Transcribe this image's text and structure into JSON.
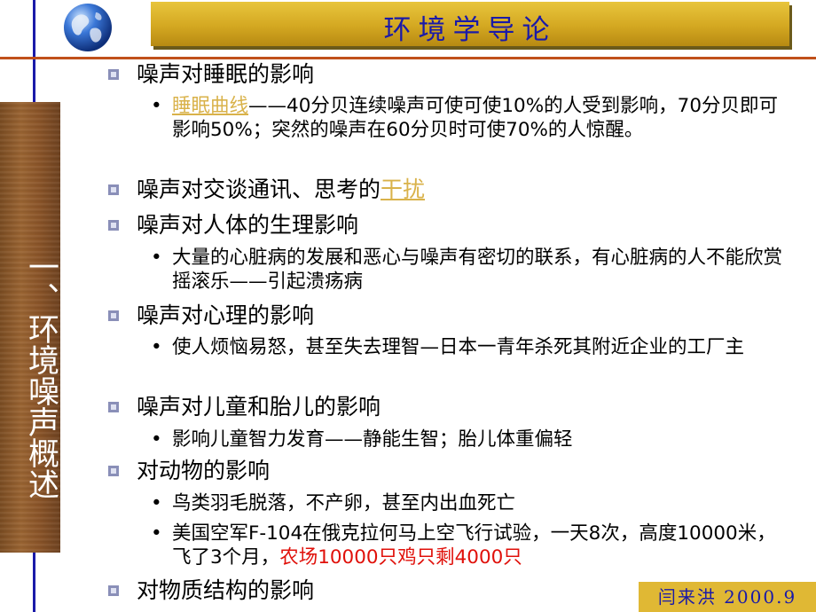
{
  "title": "环境学导论",
  "side_title": "一、环境噪声概述",
  "footer": "闫来洪 2000.9",
  "colors": {
    "title_blue": "#1a1aa8",
    "gold": "#d4a821",
    "link_gold": "#d9b24a",
    "red": "#e0100a"
  },
  "items": [
    {
      "heading": "噪声对睡眠的影响",
      "sub": [
        {
          "link": "睡眠曲线",
          "text": "——40分贝连续噪声可使可使10%的人受到影响，70分贝即可影响50%；突然的噪声在60分贝时可使70%的人惊醒。"
        }
      ]
    },
    {
      "heading_pre": "噪声对交谈通讯、思考的",
      "heading_link": "干扰"
    },
    {
      "heading": "噪声对人体的生理影响",
      "sub": [
        {
          "text": "大量的心脏病的发展和恶心与噪声有密切的联系，有心脏病的人不能欣赏摇滚乐——引起溃疡病"
        }
      ]
    },
    {
      "heading": "噪声对心理的影响",
      "sub": [
        {
          "text": "使人烦恼易怒，甚至失去理智—日本一青年杀死其附近企业的工厂主"
        }
      ]
    },
    {
      "heading": "噪声对儿童和胎儿的影响",
      "sub": [
        {
          "text": "影响儿童智力发育——静能生智；胎儿体重偏轻"
        }
      ]
    },
    {
      "heading": "对动物的影响",
      "sub": [
        {
          "text": "鸟类羽毛脱落，不产卵，甚至内出血死亡"
        },
        {
          "text": "美国空军F-104在俄克拉何马上空飞行试验，一天8次，高度10000米，飞了3个月，",
          "red": "农场10000只鸡只剩4000只"
        }
      ]
    },
    {
      "heading": "对物质结构的影响"
    }
  ]
}
